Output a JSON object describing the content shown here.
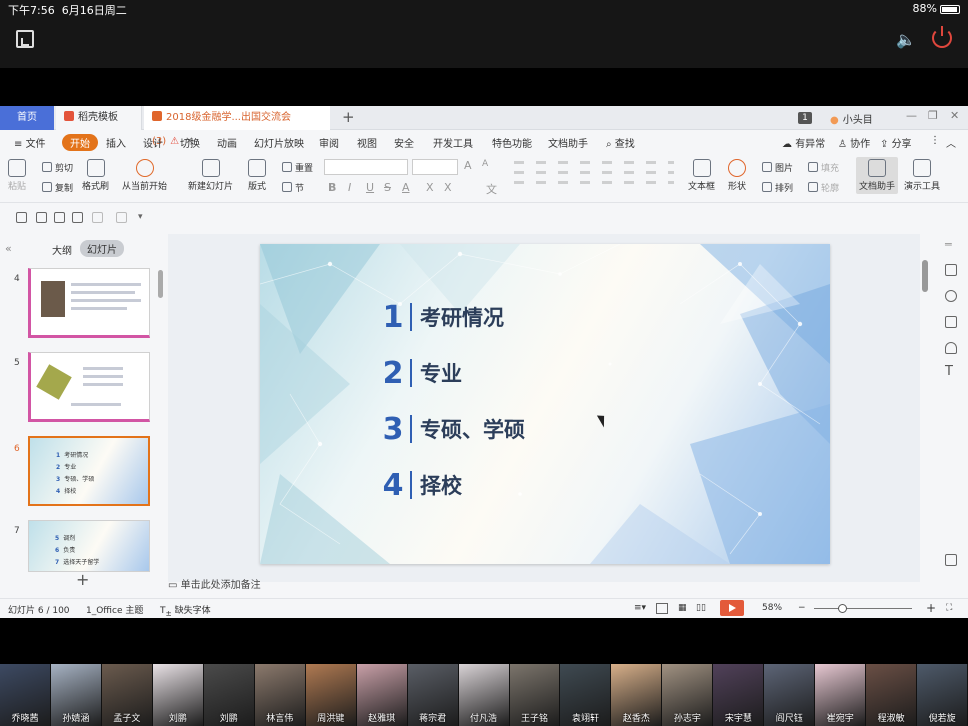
{
  "status": {
    "time": "下午7:56",
    "date": "6月16日周二",
    "battery": "88%"
  },
  "tabs": {
    "home": "首页",
    "template": "稻壳模板",
    "document": "2018级金融学...出国交流会(3)"
  },
  "user": {
    "badge": "1",
    "name": "小头目"
  },
  "menu": {
    "file": "文件",
    "start": "开始",
    "items": [
      "插入",
      "设计",
      "切换",
      "动画",
      "幻灯片放映",
      "审阅",
      "视图",
      "安全",
      "开发工具",
      "特色功能",
      "文档助手"
    ],
    "search": "查找",
    "anomaly": "有异常",
    "collab": "协作",
    "share": "分享"
  },
  "ribbon": {
    "paste": "粘贴",
    "cut": "剪切",
    "copy": "复制",
    "format_painter": "格式刷",
    "from_current": "从当前开始",
    "new_slide": "新建幻灯片",
    "layout": "版式",
    "reset": "重置",
    "section": "节",
    "textbox": "文本框",
    "shape": "形状",
    "picture": "图片",
    "fill": "填充",
    "arrange": "排列",
    "outline": "轮廓",
    "doc_assistant": "文档助手",
    "present_tools": "演示工具",
    "font_a_up": "A",
    "font_a_down": "A",
    "bold": "B",
    "italic": "I",
    "underline": "U",
    "strike": "S",
    "color_a": "A",
    "xsup": "X",
    "xsub": "X",
    "wen": "文"
  },
  "panel": {
    "outline_tab": "大纲",
    "slides_tab": "幻灯片"
  },
  "thumbnails": [
    {
      "num": "4",
      "items": []
    },
    {
      "num": "5",
      "items": []
    },
    {
      "num": "6",
      "items": [
        {
          "n": "1",
          "t": "考研情况"
        },
        {
          "n": "2",
          "t": "专业"
        },
        {
          "n": "3",
          "t": "专硕、学硕"
        },
        {
          "n": "4",
          "t": "择校"
        }
      ]
    },
    {
      "num": "7",
      "items": [
        {
          "n": "5",
          "t": "调剂"
        },
        {
          "n": "6",
          "t": "负责"
        },
        {
          "n": "7",
          "t": "选择天子留学"
        }
      ]
    }
  ],
  "slide": {
    "items": [
      {
        "n": "1",
        "t": "考研情况"
      },
      {
        "n": "2",
        "t": "专业"
      },
      {
        "n": "3",
        "t": "专硕、学硕"
      },
      {
        "n": "4",
        "t": "择校"
      }
    ]
  },
  "notes_placeholder": "单击此处添加备注",
  "statusbar": {
    "slide_count": "幻灯片 6 / 100",
    "theme": "1_Office 主题",
    "missing_font": "缺失字体",
    "zoom": "58%"
  },
  "participants": [
    "乔晓茜",
    "孙婧涵",
    "孟子文",
    "刘鹏",
    "刘鹏",
    "林言伟",
    "周洪键",
    "赵雅琪",
    "蒋宗君",
    "付凡浩",
    "王子铭",
    "袁翊轩",
    "赵香杰",
    "孙志宇",
    "宋宇慧",
    "阎尺钰",
    "崔宛宇",
    "程淑敏",
    "倪若旋"
  ]
}
